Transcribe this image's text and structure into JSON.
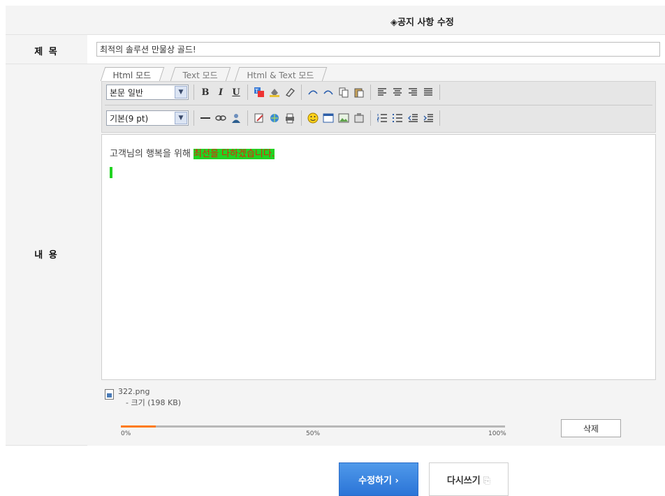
{
  "header": {
    "title": "◈공지 사항 수정"
  },
  "form": {
    "title_label": "제 목",
    "title_value": "최적의 솔루션 만물상 골드!",
    "content_label": "내 용"
  },
  "editor": {
    "tabs": [
      {
        "label": "Html 모드",
        "active": true
      },
      {
        "label": "Text 모드",
        "active": false
      },
      {
        "label": "Html & Text 모드",
        "active": false
      }
    ],
    "style_select": "본문 일반",
    "size_select": "기본(9 pt)",
    "toolbar_icons": {
      "bold": "B",
      "italic": "I",
      "underline": "U",
      "row1": [
        "font-color-icon",
        "bg-color-icon",
        "eraser-icon",
        "redo-icon",
        "undo-icon",
        "copy-icon",
        "paste-icon",
        "align-left-icon",
        "align-center-icon",
        "align-right-icon",
        "align-justify-icon"
      ],
      "row2": [
        "horizontal-rule-icon",
        "link-icon",
        "user-icon",
        "edit-icon",
        "web-icon",
        "print-icon",
        "emoticon-icon",
        "table-icon",
        "image-icon",
        "media-icon",
        "ordered-list-icon",
        "unordered-list-icon",
        "outdent-icon",
        "indent-icon"
      ]
    },
    "content_plain": "고객님의 행복을 위해 ",
    "content_highlight": "최선을 다하겠습니다.",
    "highlight_bg": "#22d322",
    "highlight_fg": "#e81c0a"
  },
  "attachment": {
    "file_name": "322.png",
    "file_size": "- 크기 (198 KB)",
    "progress": 0.09,
    "label_0": "0%",
    "label_50": "50%",
    "label_100": "100%",
    "delete_label": "삭제"
  },
  "actions": {
    "submit_label": "수정하기 ›",
    "reset_label": "다시쓰기",
    "accent": "#3a86e0"
  }
}
